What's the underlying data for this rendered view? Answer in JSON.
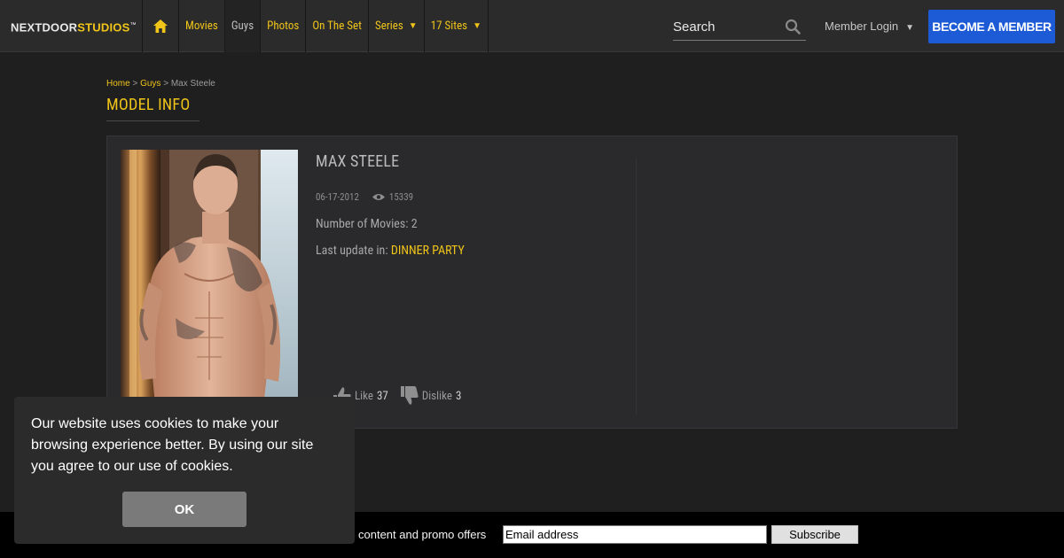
{
  "header": {
    "logo": {
      "part1": "NEXTDOOR",
      "part2": "STUDIOS",
      "tm": "™"
    },
    "nav": [
      {
        "label": "Movies"
      },
      {
        "label": "Guys"
      },
      {
        "label": "Photos"
      },
      {
        "label": "On The Set"
      },
      {
        "label": "Series"
      },
      {
        "label": "17 Sites"
      }
    ],
    "search_placeholder": "Search",
    "member_login": "Member Login",
    "become_member": "BECOME A MEMBER"
  },
  "breadcrumb": {
    "home": "Home",
    "sep1": ">",
    "guys": "Guys",
    "sep2": ">",
    "current": "Max Steele"
  },
  "page_title": "MODEL INFO",
  "model": {
    "name": "MAX STEELE",
    "date": "06-17-2012",
    "views": "15339",
    "movies_text": "Number of Movies: 2",
    "last_update_label": "Last update in:",
    "last_update_title": "DINNER PARTY",
    "like_label": "Like",
    "like_count": "37",
    "dislike_label": "Dislike",
    "dislike_count": "3"
  },
  "newsletter": {
    "text": "content and promo offers",
    "email_placeholder": "Email address",
    "subscribe": "Subscribe"
  },
  "cookie": {
    "message": "Our website uses cookies to make your browsing experience better. By using our site you agree to our use of cookies.",
    "ok": "OK"
  },
  "colors": {
    "accent": "#f0c419",
    "cta": "#1d5bd6",
    "background": "#1f1f20",
    "header": "#2b2b2c"
  }
}
